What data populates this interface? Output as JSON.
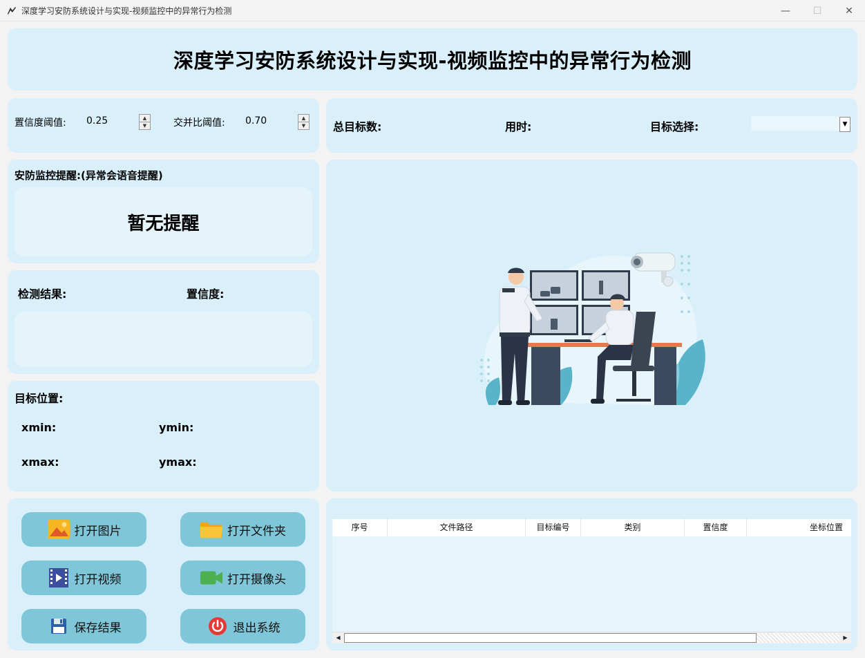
{
  "window": {
    "title": "深度学习安防系统设计与实现-视频监控中的异常行为检测",
    "minimize": "—",
    "maximize": "☐",
    "close": "✕"
  },
  "header": {
    "title": "深度学习安防系统设计与实现-视频监控中的异常行为检测"
  },
  "params": {
    "confidence_label": "置信度阈值:",
    "confidence_value": "0.25",
    "iou_label": "交并比阈值:",
    "iou_value": "0.70"
  },
  "stats": {
    "total_label": "总目标数:",
    "time_label": "用时:",
    "target_select_label": "目标选择:",
    "target_select_value": ""
  },
  "alert": {
    "heading": "安防监控提醒:(异常会语音提醒)",
    "message": "暂无提醒"
  },
  "result": {
    "detect_label": "检测结果:",
    "confidence_label": "置信度:"
  },
  "position": {
    "heading": "目标位置:",
    "xmin": "xmin:",
    "ymin": "ymin:",
    "xmax": "xmax:",
    "ymax": "ymax:"
  },
  "buttons": {
    "open_image": "打开图片",
    "open_folder": "打开文件夹",
    "open_video": "打开视频",
    "open_camera": "打开摄像头",
    "save_results": "保存结果",
    "exit_system": "退出系统"
  },
  "table": {
    "columns": [
      "序号",
      "文件路径",
      "目标编号",
      "类别",
      "置信度",
      "坐标位置"
    ]
  },
  "icons": {
    "image": "image-icon",
    "folder": "folder-icon",
    "video": "film-icon",
    "camera": "camera-icon",
    "save": "floppy-icon",
    "exit": "power-icon"
  },
  "colors": {
    "panel": "#d9f0fb",
    "button": "#7ec6d8",
    "alert_box": "#e5f4fb"
  }
}
